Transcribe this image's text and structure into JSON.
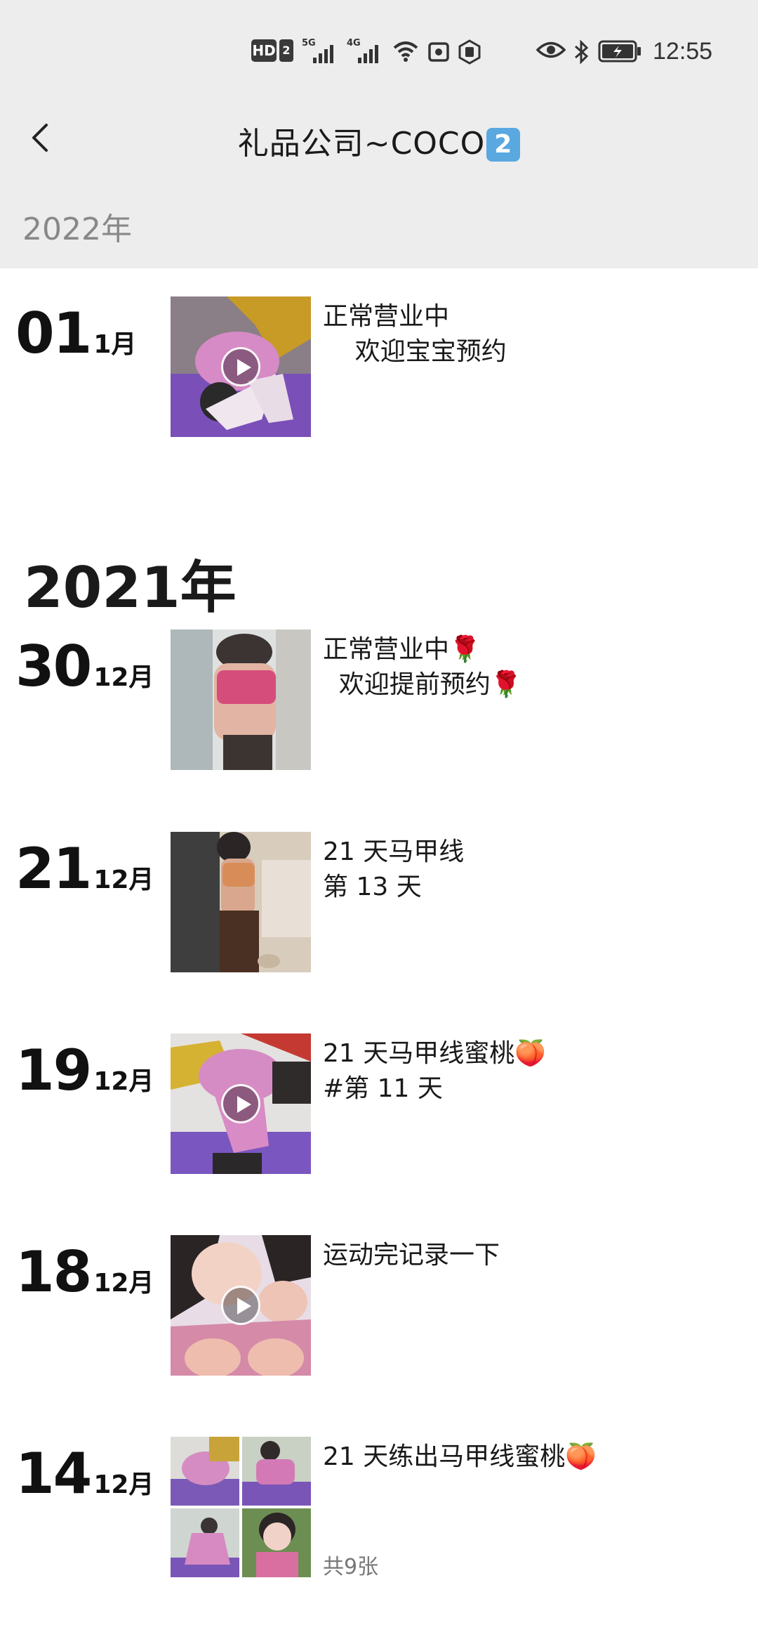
{
  "status_bar": {
    "hd": "HD",
    "sim": "2",
    "sig1": "5G",
    "sig2": "4G",
    "time": "12:55"
  },
  "header": {
    "title": "礼品公司~COCO",
    "badge": "2"
  },
  "years": {
    "first": "2022年",
    "second": "2021年"
  },
  "posts": [
    {
      "day": "01",
      "month": "1月",
      "line1": "正常营业中",
      "line2": "    欢迎宝宝预约",
      "media": "video"
    },
    {
      "day": "30",
      "month": "12月",
      "line1": "正常营业中🌹",
      "line2": "  欢迎提前预约🌹",
      "media": "photo"
    },
    {
      "day": "21",
      "month": "12月",
      "line1": "21 天马甲线",
      "line2": "第 13 天",
      "media": "photo"
    },
    {
      "day": "19",
      "month": "12月",
      "line1": "21 天马甲线蜜桃🍑",
      "line2": "#第 11 天",
      "media": "video"
    },
    {
      "day": "18",
      "month": "12月",
      "line1": "运动完记录一下",
      "line2": "",
      "media": "video"
    },
    {
      "day": "14",
      "month": "12月",
      "line1": "21 天练出马甲线蜜桃🍑",
      "line2": "",
      "media": "grid",
      "count": "共9张"
    }
  ]
}
